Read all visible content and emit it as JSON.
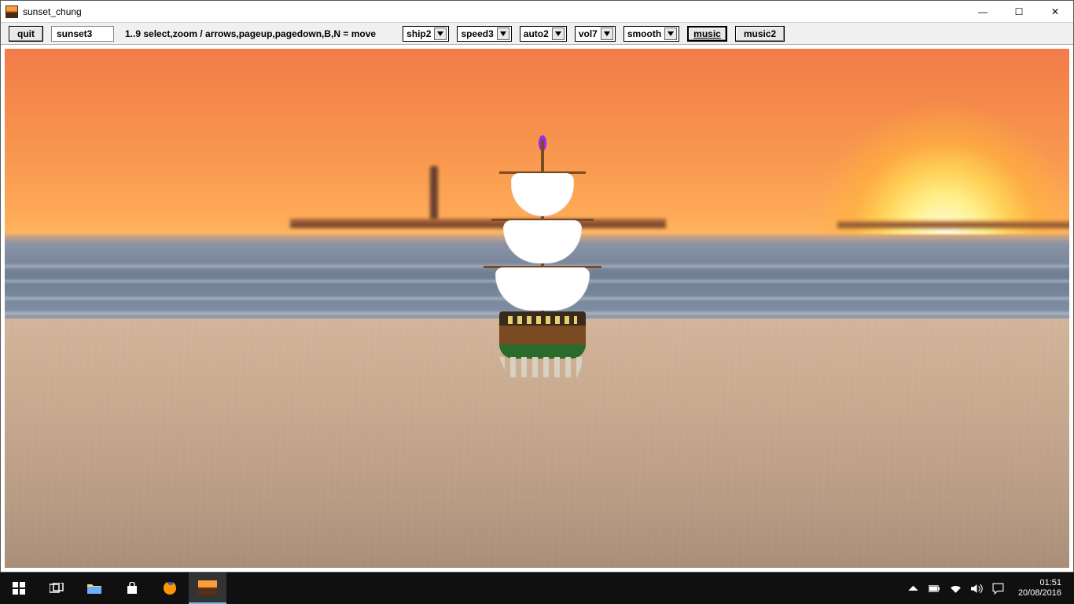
{
  "window": {
    "title": "sunset_chung",
    "controls": {
      "min": "—",
      "max": "☐",
      "close": "✕"
    }
  },
  "toolbar": {
    "quit_label": "quit",
    "scene_name": "sunset3",
    "help_text": "1..9 select,zoom / arrows,pageup,pagedown,B,N = move",
    "ship_combo": "ship2",
    "speed_combo": "speed3",
    "auto_combo": "auto2",
    "vol_combo": "vol7",
    "smooth_combo": "smooth",
    "music_label": "music",
    "music2_label": "music2"
  },
  "taskbar": {
    "time": "01:51",
    "date": "20/08/2016"
  }
}
